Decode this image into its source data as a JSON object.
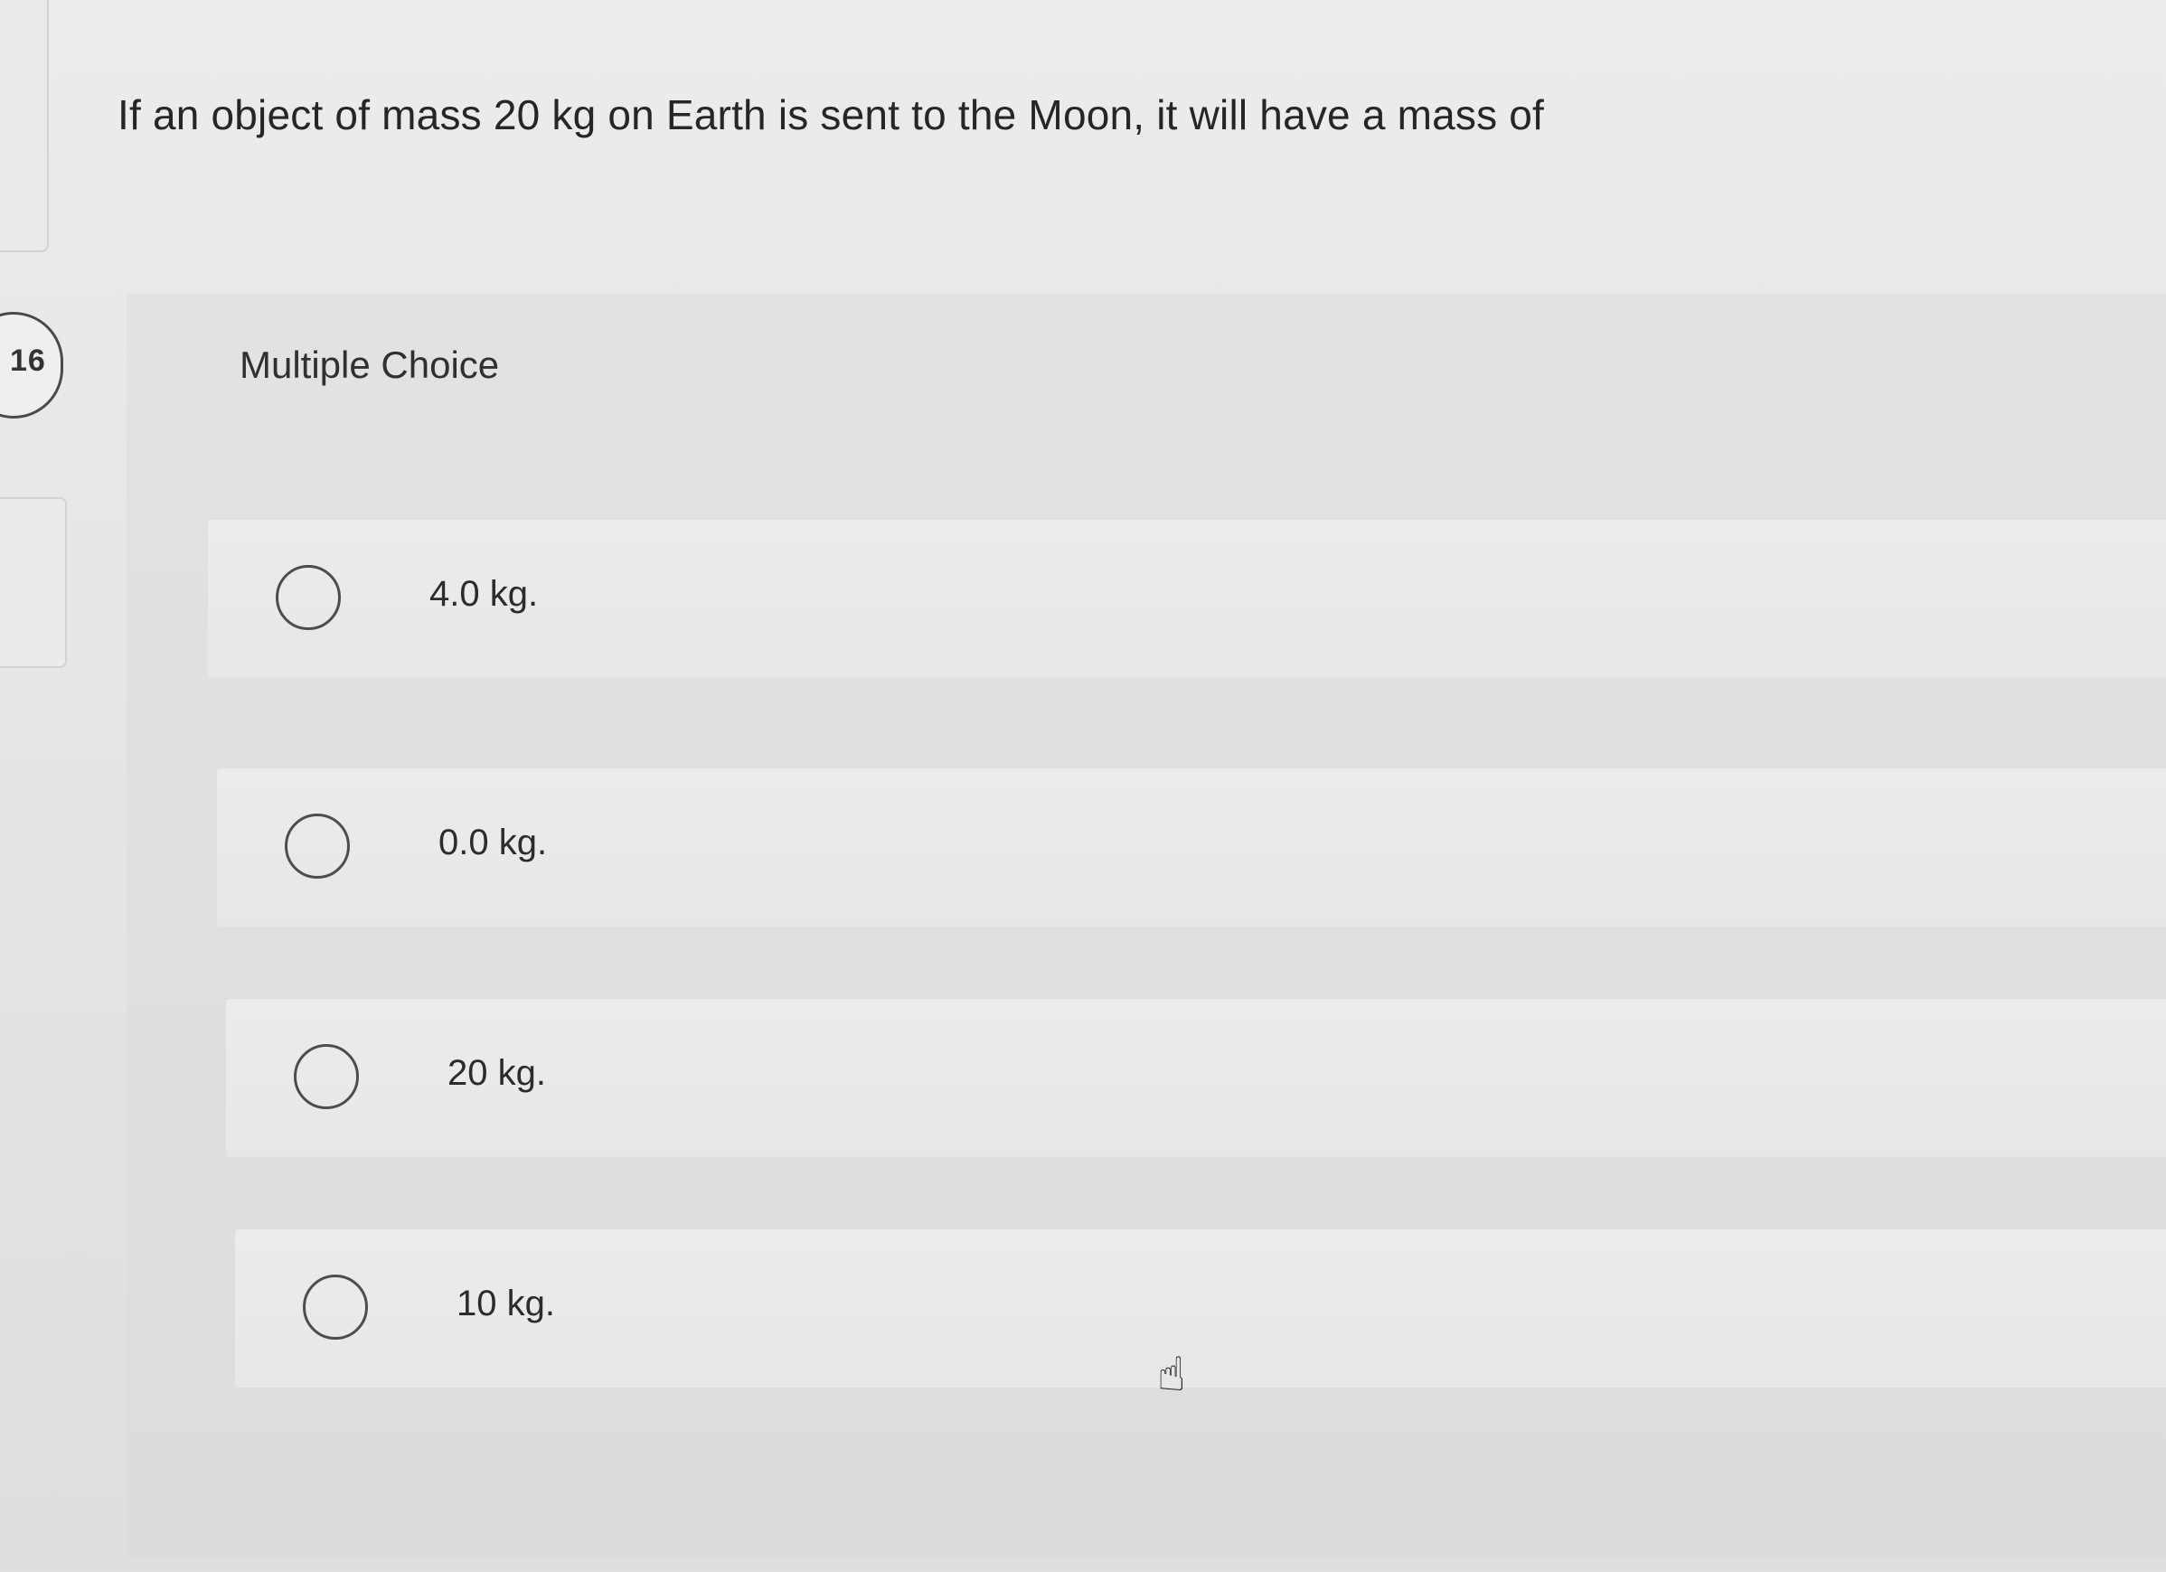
{
  "nav": {
    "question_number": "16"
  },
  "question": {
    "text": "If an object of mass 20 kg on Earth is sent to the Moon, it will have a mass of"
  },
  "choices": {
    "header": "Multiple Choice",
    "options": [
      {
        "label": "4.0 kg."
      },
      {
        "label": "0.0 kg."
      },
      {
        "label": "20 kg."
      },
      {
        "label": "10 kg."
      }
    ]
  },
  "cursor": {
    "icon": "hand-pointer-icon",
    "glyph": "☝"
  }
}
